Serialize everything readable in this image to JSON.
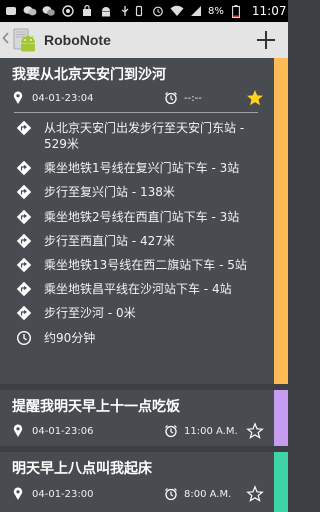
{
  "status_bar": {
    "battery": "8%",
    "clock": "11:07"
  },
  "app_bar": {
    "title": "RoboNote"
  },
  "notes": [
    {
      "title": "我要从北京天安门到沙河",
      "date": "04-01-23:04",
      "alarm": "--:--",
      "starred": true,
      "stripe_color": "#ffbb55",
      "steps": [
        {
          "icon": "direction-icon",
          "text": "从北京天安门出发步行至天安门东站 - 529米"
        },
        {
          "icon": "direction-icon",
          "text": "乘坐地铁1号线在复兴门站下车 - 3站"
        },
        {
          "icon": "direction-icon",
          "text": "步行至复兴门站 - 138米"
        },
        {
          "icon": "direction-icon",
          "text": "乘坐地铁2号线在西直门站下车 - 3站"
        },
        {
          "icon": "direction-icon",
          "text": "步行至西直门站 - 427米"
        },
        {
          "icon": "direction-icon",
          "text": "乘坐地铁13号线在西二旗站下车 - 5站"
        },
        {
          "icon": "direction-icon",
          "text": "乘坐地铁昌平线在沙河站下车 - 4站"
        },
        {
          "icon": "direction-icon",
          "text": "步行至沙河 - 0米"
        },
        {
          "icon": "clock-icon",
          "text": "约90分钟"
        }
      ]
    },
    {
      "title": "提醒我明天早上十一点吃饭",
      "date": "04-01-23:06",
      "alarm": "11:00 A.M.",
      "starred": false,
      "stripe_color": "#c59cf0"
    },
    {
      "title": "明天早上八点叫我起床",
      "date": "04-01-23:00",
      "alarm": "8:00 A.M.",
      "starred": false,
      "stripe_color": "#3fd3a8"
    }
  ],
  "colors": {
    "background": "#3c3f44",
    "card": "#484b50",
    "star_active": "#ffd21f",
    "action_bar": "#e4e4e4"
  }
}
